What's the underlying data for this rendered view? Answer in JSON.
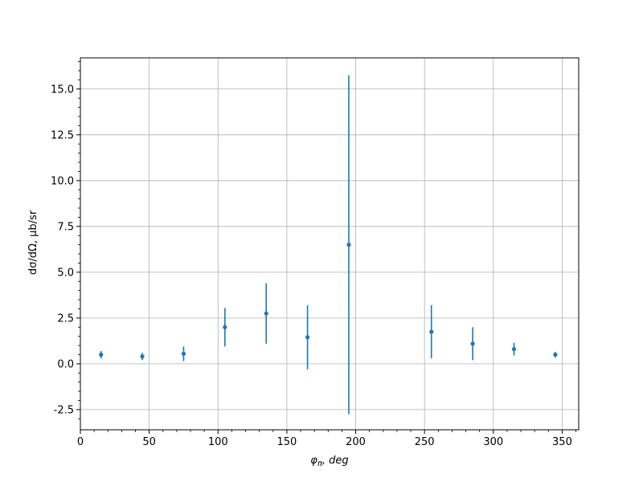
{
  "chart_data": {
    "type": "scatter",
    "xlabel_base": "φ",
    "xlabel_sub": "π",
    "xlabel_rest": ", deg",
    "ylabel": "dσ/dΩ, μb/sr",
    "xlim": [
      0,
      362
    ],
    "ylim": [
      -3.6,
      16.7
    ],
    "xticks": [
      0,
      50,
      100,
      150,
      200,
      250,
      300,
      350
    ],
    "yticks": [
      -2.5,
      0.0,
      2.5,
      5.0,
      7.5,
      10.0,
      12.5,
      15.0
    ],
    "grid": true,
    "color": "#1f77b4",
    "points": [
      {
        "x": 15,
        "y": 0.5,
        "err": 0.2
      },
      {
        "x": 45,
        "y": 0.4,
        "err": 0.2
      },
      {
        "x": 75,
        "y": 0.55,
        "err": 0.4
      },
      {
        "x": 105,
        "y": 2.0,
        "err": 1.05
      },
      {
        "x": 135,
        "y": 2.75,
        "err": 1.65
      },
      {
        "x": 165,
        "y": 1.45,
        "err": 1.75
      },
      {
        "x": 195,
        "y": 6.5,
        "err": 9.25
      },
      {
        "x": 255,
        "y": 1.75,
        "err": 1.45
      },
      {
        "x": 285,
        "y": 1.1,
        "err": 0.9
      },
      {
        "x": 315,
        "y": 0.8,
        "err": 0.35
      },
      {
        "x": 345,
        "y": 0.5,
        "err": 0.15
      }
    ]
  }
}
